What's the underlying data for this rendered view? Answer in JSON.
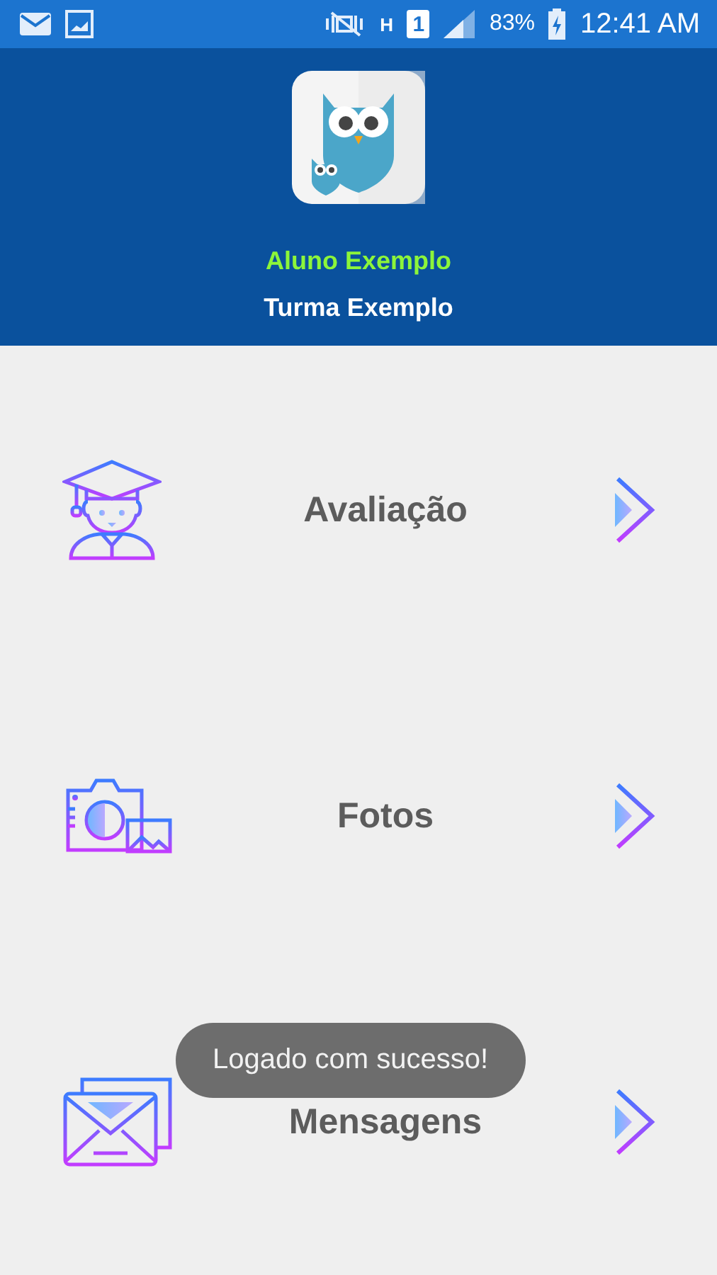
{
  "status_bar": {
    "network": "H",
    "sim": "1",
    "battery": "83%",
    "time": "12:41 AM"
  },
  "header": {
    "student": "Aluno Exemplo",
    "class": "Turma Exemplo"
  },
  "menu": [
    {
      "kind": "grades",
      "label": "Avaliação"
    },
    {
      "kind": "photos",
      "label": "Fotos"
    },
    {
      "kind": "messages",
      "label": "Mensagens"
    }
  ],
  "toast": "Logado com sucesso!"
}
